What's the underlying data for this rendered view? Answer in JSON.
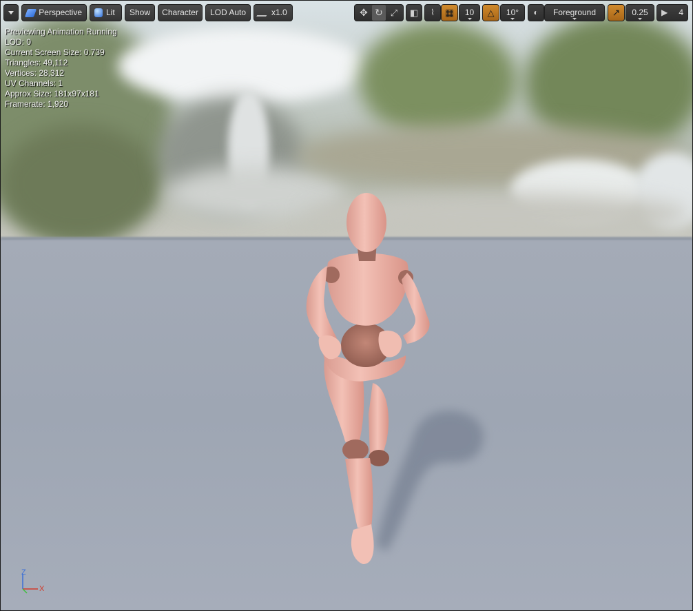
{
  "toolbar": {
    "view_mode": "Perspective",
    "lit_mode": "Lit",
    "show_label": "Show",
    "character_label": "Character",
    "lod_label": "LOD Auto",
    "speed_label": "x1.0",
    "grid_snap_value": "10",
    "rotation_snap_value": "10°",
    "layer_label": "Foreground",
    "scale_snap_value": "0.25",
    "camera_speed_value": "4"
  },
  "stats": {
    "line1": "Previewing Animation Running",
    "line2": "LOD: 0",
    "line3": "Current Screen Size: 0.739",
    "line4": "Triangles: 49,112",
    "line5": "Vertices: 28,312",
    "line6": "UV Channels: 1",
    "line7": "Approx Size: 181x97x181",
    "line8": "Framerate: 1,920"
  },
  "axis": {
    "z_label": "Z",
    "x_label": "X"
  },
  "colors": {
    "accent_orange": "#c07a22",
    "floor": "#a6adba",
    "mannequin": "#eab3a8"
  }
}
